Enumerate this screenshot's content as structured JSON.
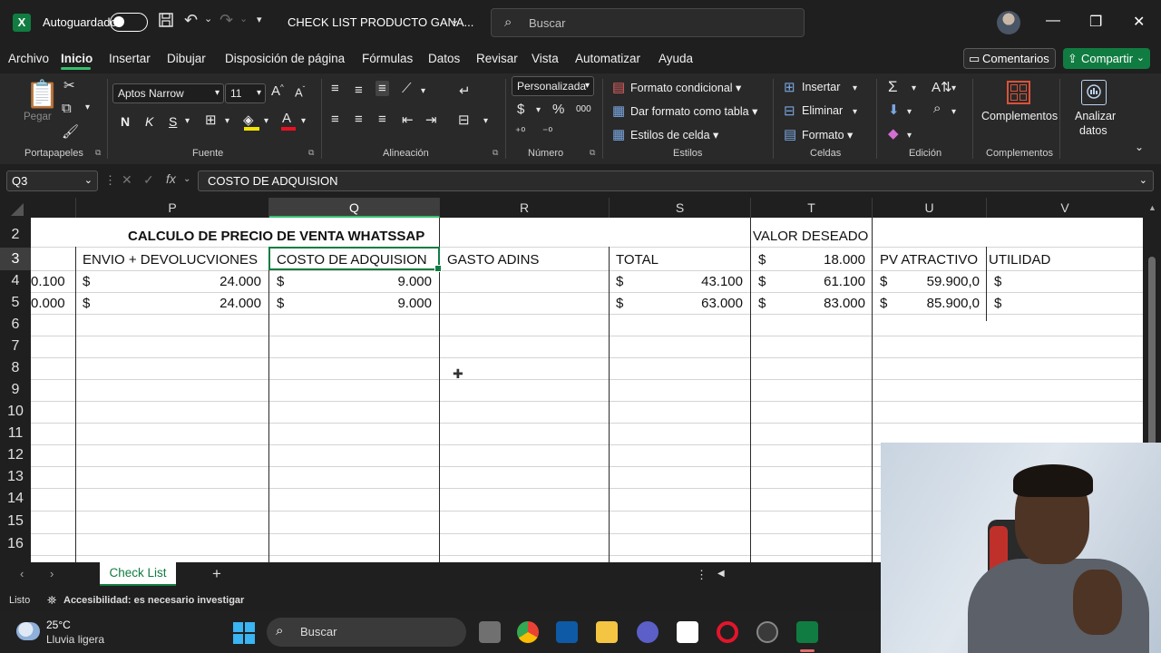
{
  "titlebar": {
    "autosave_label": "Autoguardado",
    "file_name": "CHECK LIST PRODUCTO GANA...",
    "search_placeholder": "Buscar"
  },
  "menu": {
    "items": [
      "Archivo",
      "Inicio",
      "Insertar",
      "Dibujar",
      "Disposición de página",
      "Fórmulas",
      "Datos",
      "Revisar",
      "Vista",
      "Automatizar",
      "Ayuda"
    ],
    "active": "Inicio",
    "comments_label": "Comentarios",
    "share_label": "Compartir"
  },
  "ribbon": {
    "paste_label": "Pegar",
    "font_name": "Aptos Narrow",
    "font_size": "11",
    "bold": "N",
    "italic": "K",
    "underline": "S",
    "number_format": "Personalizada",
    "conditional_format": "Formato condicional",
    "format_as_table": "Dar formato como tabla",
    "cell_styles": "Estilos de celda",
    "insert": "Insertar",
    "delete": "Eliminar",
    "format": "Formato",
    "addins": "Complementos",
    "analyze_line1": "Analizar",
    "analyze_line2": "datos",
    "groups": {
      "clipboard": "Portapapeles",
      "font": "Fuente",
      "alignment": "Alineación",
      "number": "Número",
      "styles": "Estilos",
      "cells": "Celdas",
      "editing": "Edición",
      "addins": "Complementos"
    }
  },
  "formula_bar": {
    "name_box": "Q3",
    "fx": "fx",
    "content": "COSTO DE ADQUISION"
  },
  "grid": {
    "columns": [
      "P",
      "Q",
      "R",
      "S",
      "T",
      "U",
      "V"
    ],
    "selected_column": "Q",
    "rows": [
      "2",
      "3",
      "4",
      "5",
      "6",
      "7",
      "8",
      "9",
      "10",
      "11",
      "12",
      "13",
      "14",
      "15",
      "16"
    ],
    "selected_row": "3",
    "title": "CALCULO DE PRECIO DE VENTA WHATSSAP",
    "valor_deseado": "VALOR DESEADO",
    "headers": {
      "P": "ENVIO + DEVOLUCVIONES",
      "Q": "COSTO DE ADQUISION",
      "R": "GASTO ADINS",
      "S": "TOTAL",
      "T_symbol": "$",
      "T_value": "18.000",
      "U": "PV ATRACTIVO",
      "V": "UTILIDAD"
    },
    "data_rows": [
      {
        "O": "0.100",
        "P_sym": "$",
        "P": "24.000",
        "Q_sym": "$",
        "Q": "9.000",
        "S_sym": "$",
        "S": "43.100",
        "T_sym": "$",
        "T": "61.100",
        "U_sym": "$",
        "U": "59.900,0",
        "V_sym": "$"
      },
      {
        "O": "0.000",
        "P_sym": "$",
        "P": "24.000",
        "Q_sym": "$",
        "Q": "9.000",
        "S_sym": "$",
        "S": "63.000",
        "T_sym": "$",
        "T": "83.000",
        "U_sym": "$",
        "U": "85.900,0",
        "V_sym": "$"
      }
    ]
  },
  "sheet_tabs": {
    "active": "Check List"
  },
  "status": {
    "ready": "Listo",
    "accessibility": "Accesibilidad: es necesario investigar"
  },
  "taskbar": {
    "temperature": "25°C",
    "weather": "Lluvia ligera",
    "search_placeholder": "Buscar"
  },
  "colors": {
    "excel_green": "#107c41",
    "accent_green": "#37c06d"
  }
}
